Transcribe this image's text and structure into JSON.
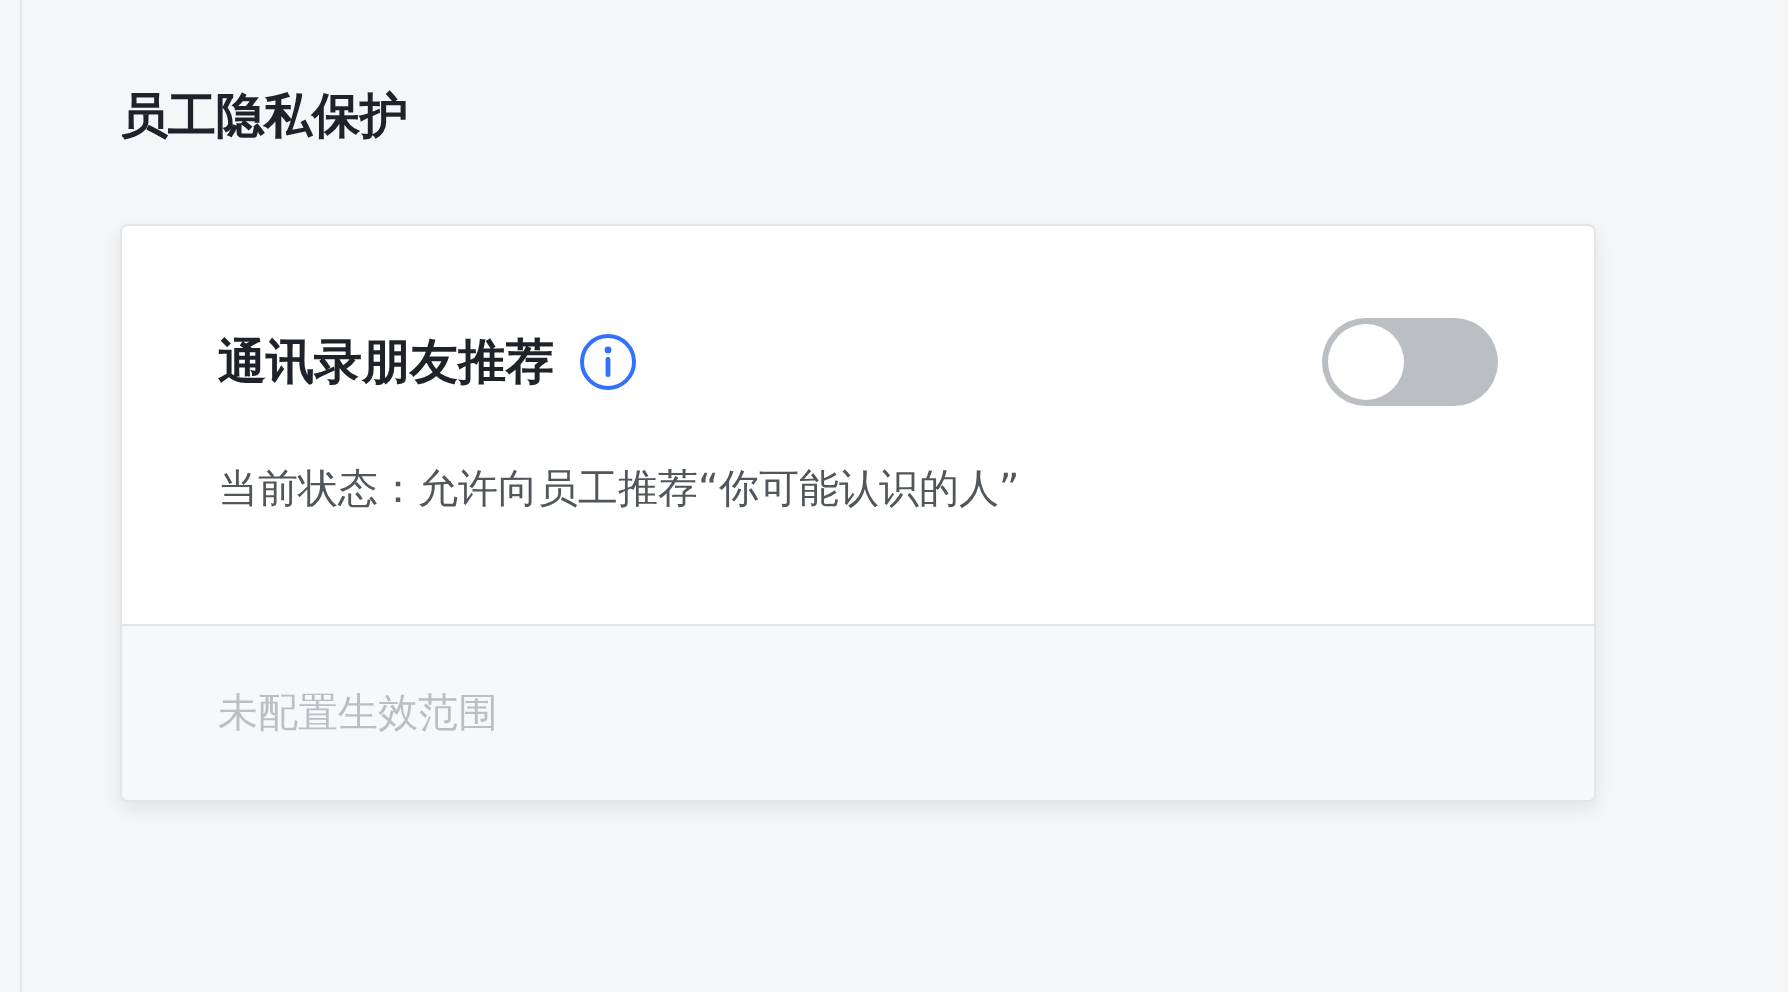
{
  "section_title": "员工隐私保护",
  "setting": {
    "title": "通讯录朋友推荐",
    "toggle": {
      "on": false
    },
    "status": "当前状态：允许向员工推荐“你可能认识的人”",
    "footer": "未配置生效范围"
  }
}
